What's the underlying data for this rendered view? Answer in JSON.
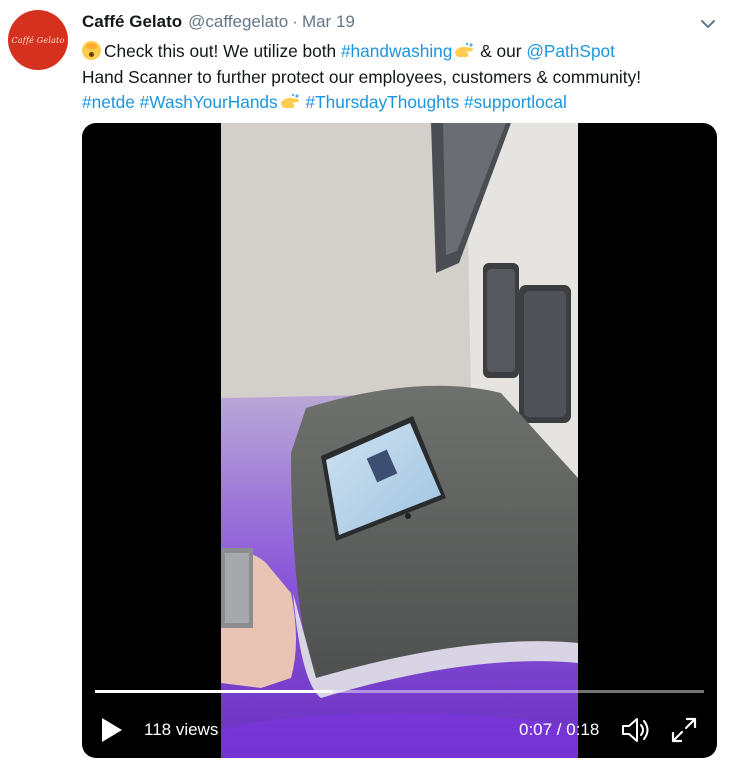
{
  "tweet": {
    "avatar_text": "Caffé Gelato",
    "author_name": "Caffé Gelato",
    "handle": "@caffegelato",
    "separator": "·",
    "date": "Mar 19",
    "body": {
      "line1_pre": "Check this out! We utilize both ",
      "hashtag_handwashing": "#handwashing",
      "line1_mid": " & our ",
      "mention_pathspot": "@PathSpot",
      "line2": "Hand Scanner to further protect our employees, customers & community!",
      "hashtag_netde": "#netde",
      "hashtag_washyourhands": "#WashYourHands",
      "hashtag_thursdaythoughts": "#ThursdayThoughts",
      "hashtag_supportlocal": "#supportlocal"
    },
    "emojis": [
      "exploding-head-emoji",
      "washing-hands-emoji"
    ],
    "link_color": "#1b95e0",
    "muted_color": "#657786"
  },
  "video": {
    "views": "118 views",
    "time_display": "0:07 / 0:18",
    "progress_fraction": 0.389,
    "icons": [
      "play-icon",
      "volume-icon",
      "fullscreen-icon"
    ]
  }
}
